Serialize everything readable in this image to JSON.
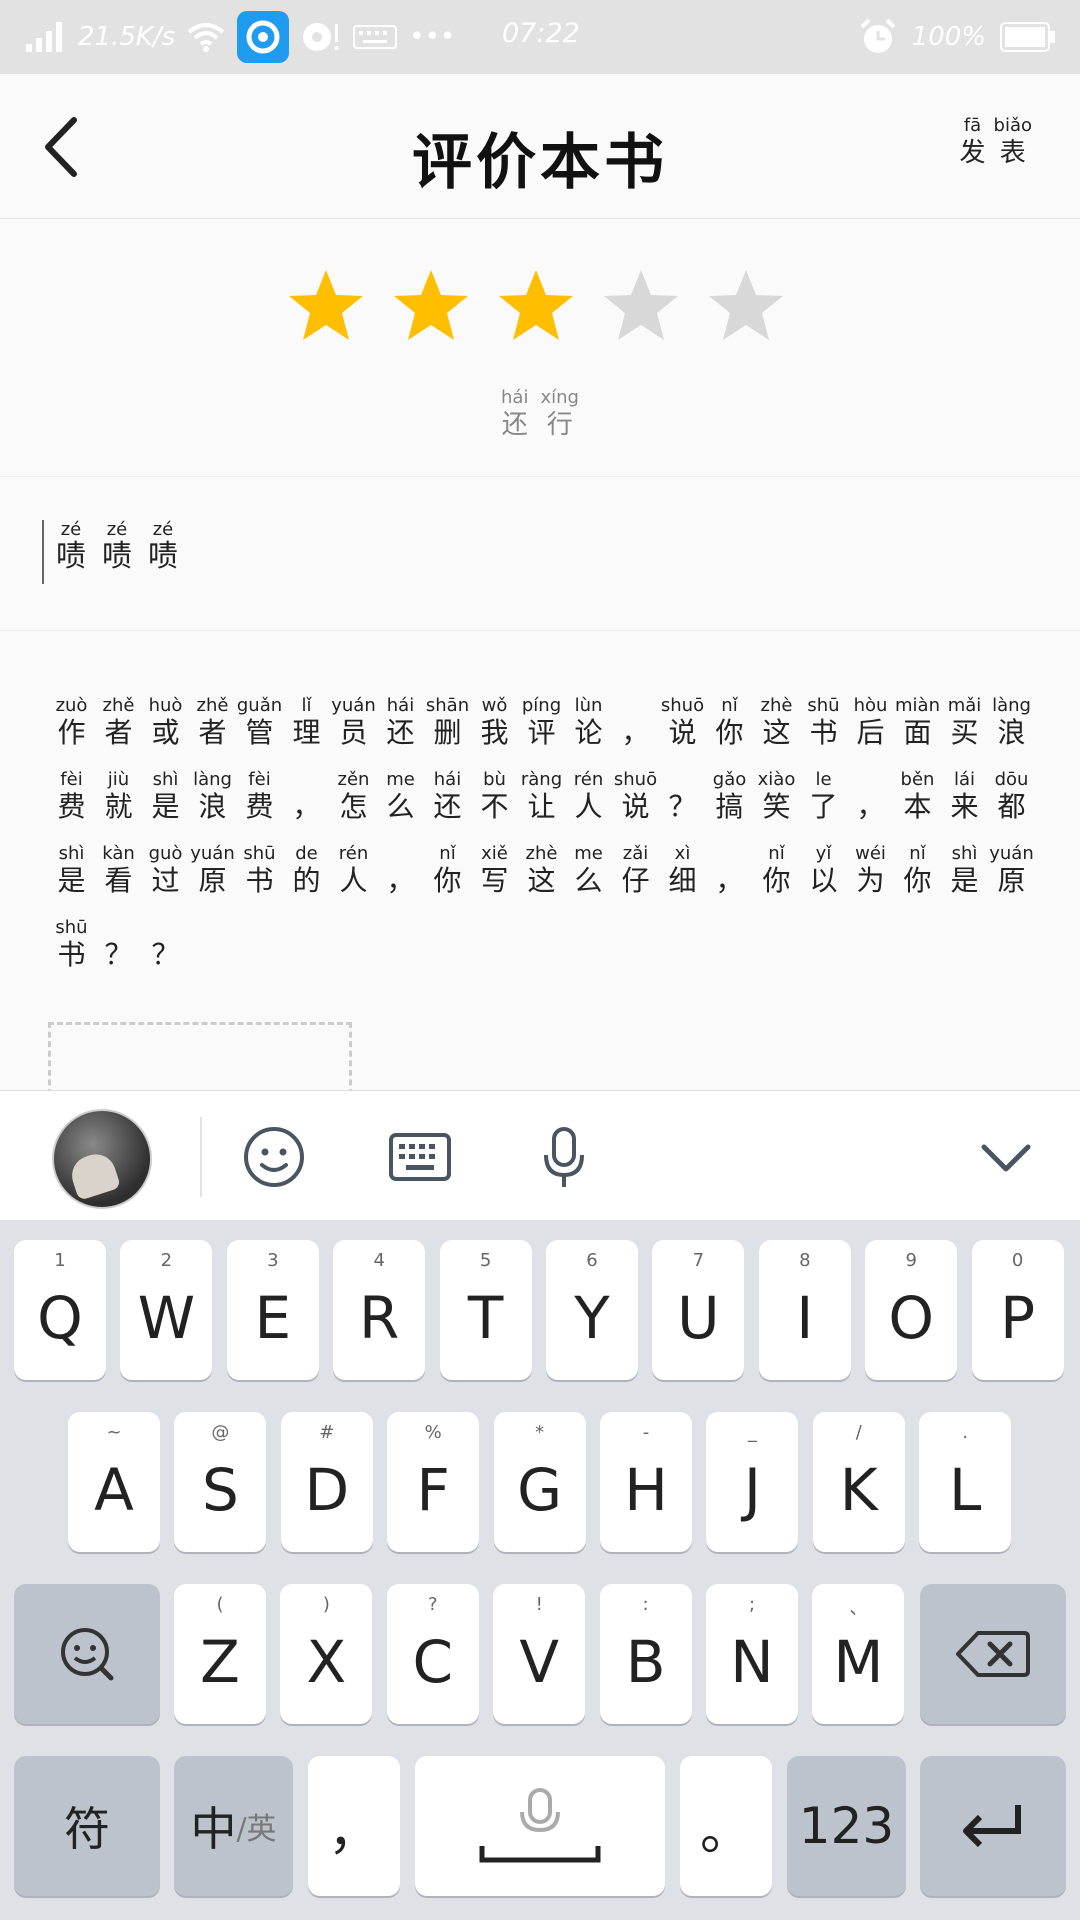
{
  "status_bar": {
    "net_speed": "21.5K/s",
    "dots": "•••",
    "time": "07:22",
    "battery": "100%"
  },
  "header": {
    "title": "评价本书",
    "publish": [
      {
        "py": "fā",
        "hz": "发"
      },
      {
        "py": "biǎo",
        "hz": "表"
      }
    ]
  },
  "rating": {
    "value": 3,
    "max": 5,
    "filled_color": "#ffbf00",
    "empty_color": "#d8d8d8",
    "label": [
      {
        "py": "hái",
        "hz": "还"
      },
      {
        "py": "xíng",
        "hz": "行"
      }
    ]
  },
  "title_input": [
    {
      "py": "zé",
      "hz": "啧"
    },
    {
      "py": "zé",
      "hz": "啧"
    },
    {
      "py": "zé",
      "hz": "啧"
    }
  ],
  "body_lines": [
    [
      {
        "py": "zuò",
        "hz": "作"
      },
      {
        "py": "zhě",
        "hz": "者"
      },
      {
        "py": "huò",
        "hz": "或"
      },
      {
        "py": "zhě",
        "hz": "者"
      },
      {
        "py": "guǎn",
        "hz": "管"
      },
      {
        "py": "lǐ",
        "hz": "理"
      },
      {
        "py": "yuán",
        "hz": "员"
      },
      {
        "py": "hái",
        "hz": "还"
      },
      {
        "py": "shān",
        "hz": "删"
      },
      {
        "py": "wǒ",
        "hz": "我"
      },
      {
        "py": "píng",
        "hz": "评"
      },
      {
        "py": "lùn",
        "hz": "论"
      },
      {
        "py": "",
        "hz": "，"
      },
      {
        "py": "shuō",
        "hz": "说"
      },
      {
        "py": "nǐ",
        "hz": "你"
      },
      {
        "py": "zhè",
        "hz": "这"
      },
      {
        "py": "shū",
        "hz": "书"
      },
      {
        "py": "hòu",
        "hz": "后"
      },
      {
        "py": "miàn",
        "hz": "面"
      },
      {
        "py": "mǎi",
        "hz": "买"
      },
      {
        "py": "làng",
        "hz": "浪"
      }
    ],
    [
      {
        "py": "fèi",
        "hz": "费"
      },
      {
        "py": "jiù",
        "hz": "就"
      },
      {
        "py": "shì",
        "hz": "是"
      },
      {
        "py": "làng",
        "hz": "浪"
      },
      {
        "py": "fèi",
        "hz": "费"
      },
      {
        "py": "",
        "hz": "，"
      },
      {
        "py": "zěn",
        "hz": "怎"
      },
      {
        "py": "me",
        "hz": "么"
      },
      {
        "py": "hái",
        "hz": "还"
      },
      {
        "py": "bù",
        "hz": "不"
      },
      {
        "py": "ràng",
        "hz": "让"
      },
      {
        "py": "rén",
        "hz": "人"
      },
      {
        "py": "shuō",
        "hz": "说"
      },
      {
        "py": "",
        "hz": "？"
      },
      {
        "py": "gǎo",
        "hz": "搞"
      },
      {
        "py": "xiào",
        "hz": "笑"
      },
      {
        "py": "le",
        "hz": "了"
      },
      {
        "py": "",
        "hz": "，"
      },
      {
        "py": "běn",
        "hz": "本"
      },
      {
        "py": "lái",
        "hz": "来"
      },
      {
        "py": "dōu",
        "hz": "都"
      }
    ],
    [
      {
        "py": "shì",
        "hz": "是"
      },
      {
        "py": "kàn",
        "hz": "看"
      },
      {
        "py": "guò",
        "hz": "过"
      },
      {
        "py": "yuán",
        "hz": "原"
      },
      {
        "py": "shū",
        "hz": "书"
      },
      {
        "py": "de",
        "hz": "的"
      },
      {
        "py": "rén",
        "hz": "人"
      },
      {
        "py": "",
        "hz": "，"
      },
      {
        "py": "nǐ",
        "hz": "你"
      },
      {
        "py": "xiě",
        "hz": "写"
      },
      {
        "py": "zhè",
        "hz": "这"
      },
      {
        "py": "me",
        "hz": "么"
      },
      {
        "py": "zǎi",
        "hz": "仔"
      },
      {
        "py": "xì",
        "hz": "细"
      },
      {
        "py": "",
        "hz": "，"
      },
      {
        "py": "nǐ",
        "hz": "你"
      },
      {
        "py": "yǐ",
        "hz": "以"
      },
      {
        "py": "wéi",
        "hz": "为"
      },
      {
        "py": "nǐ",
        "hz": "你"
      },
      {
        "py": "shì",
        "hz": "是"
      },
      {
        "py": "yuán",
        "hz": "原"
      }
    ],
    [
      {
        "py": "shū",
        "hz": "书"
      },
      {
        "py": "",
        "hz": "？"
      },
      {
        "py": "",
        "hz": "？"
      }
    ]
  ],
  "keyboard": {
    "row1": [
      {
        "k": "Q",
        "s": "1"
      },
      {
        "k": "W",
        "s": "2"
      },
      {
        "k": "E",
        "s": "3"
      },
      {
        "k": "R",
        "s": "4"
      },
      {
        "k": "T",
        "s": "5"
      },
      {
        "k": "Y",
        "s": "6"
      },
      {
        "k": "U",
        "s": "7"
      },
      {
        "k": "I",
        "s": "8"
      },
      {
        "k": "O",
        "s": "9"
      },
      {
        "k": "P",
        "s": "0"
      }
    ],
    "row2": [
      {
        "k": "A",
        "s": "~"
      },
      {
        "k": "S",
        "s": "@"
      },
      {
        "k": "D",
        "s": "#"
      },
      {
        "k": "F",
        "s": "%"
      },
      {
        "k": "G",
        "s": "*"
      },
      {
        "k": "H",
        "s": "-"
      },
      {
        "k": "J",
        "s": "_"
      },
      {
        "k": "K",
        "s": "/"
      },
      {
        "k": "L",
        "s": "."
      }
    ],
    "row3": [
      {
        "k": "Z",
        "s": "("
      },
      {
        "k": "X",
        "s": ")"
      },
      {
        "k": "C",
        "s": "?"
      },
      {
        "k": "V",
        "s": "!"
      },
      {
        "k": "B",
        "s": ":"
      },
      {
        "k": "N",
        "s": ";"
      },
      {
        "k": "M",
        "s": "、"
      }
    ],
    "symbols_label": "符",
    "lang_label_main": "中",
    "lang_label_sub": "/英",
    "comma": "，",
    "period": "。",
    "num_label": "123"
  }
}
